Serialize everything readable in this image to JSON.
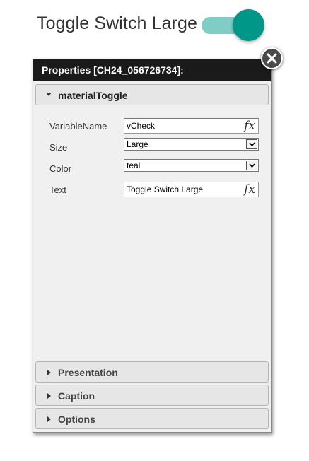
{
  "toggle": {
    "label": "Toggle Switch Large",
    "state": "on",
    "track_color": "#7fcdc4",
    "thumb_color": "#009688"
  },
  "panel": {
    "title": "Properties [CH24_056726734]:",
    "close_icon": "close-icon",
    "sections": {
      "main": {
        "title": "materialToggle",
        "expanded": true
      },
      "presentation": {
        "title": "Presentation",
        "expanded": false
      },
      "caption": {
        "title": "Caption",
        "expanded": false
      },
      "options": {
        "title": "Options",
        "expanded": false
      }
    },
    "properties": {
      "variable_name": {
        "label": "VariableName",
        "value": "vCheck",
        "fx": "fx"
      },
      "size": {
        "label": "Size",
        "value": "Large"
      },
      "color": {
        "label": "Color",
        "value": "teal"
      },
      "text": {
        "label": "Text",
        "value": "Toggle Switch Large",
        "fx": "fx"
      }
    }
  }
}
